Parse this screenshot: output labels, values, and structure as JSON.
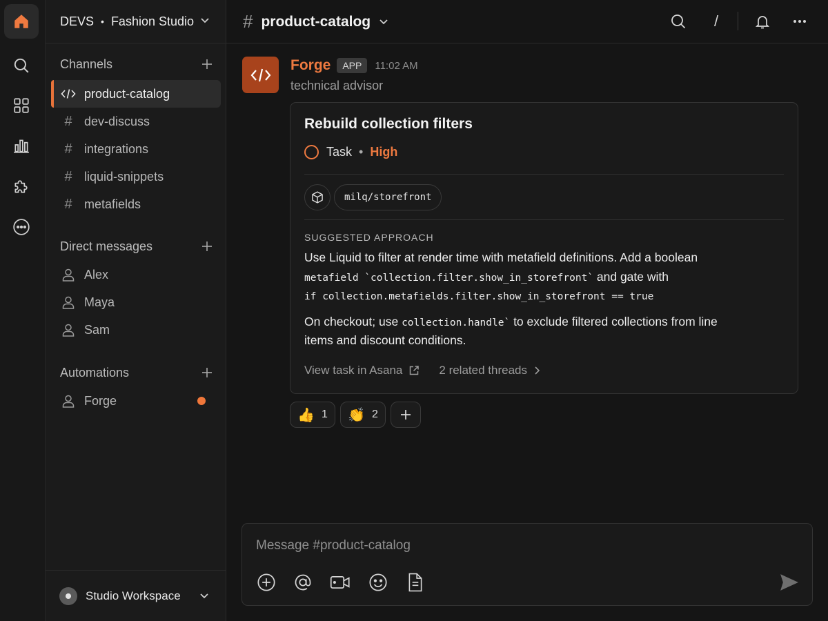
{
  "workspace": {
    "org": "DEVS",
    "separator": "•",
    "name": "Fashion Studio",
    "footer_name": "Studio Workspace"
  },
  "rail": {
    "icons": [
      "home-icon",
      "search-icon",
      "apps-grid-icon",
      "analytics-icon",
      "puzzle-icon",
      "more-circle-icon"
    ],
    "active": "home-icon"
  },
  "sidebar": {
    "channels_label": "Channels",
    "channels": [
      {
        "label": "product-catalog",
        "icon": "code-icon",
        "active": true
      },
      {
        "label": "dev-discuss",
        "icon": "hash"
      },
      {
        "label": "integrations",
        "icon": "hash"
      },
      {
        "label": "liquid-snippets",
        "icon": "hash"
      },
      {
        "label": "metafields",
        "icon": "hash"
      }
    ],
    "dm_label": "Direct messages",
    "dms": [
      {
        "label": "Alex"
      },
      {
        "label": "Maya"
      },
      {
        "label": "Sam"
      }
    ],
    "automations_label": "Automations",
    "automations": [
      {
        "label": "Forge",
        "unread": true
      }
    ],
    "hash_glyph": "#"
  },
  "topbar": {
    "hash": "#",
    "channel": "product-catalog",
    "slash": "/"
  },
  "message": {
    "sender": "Forge",
    "badge": "APP",
    "time": "11:02 AM",
    "subtitle": "technical advisor",
    "card": {
      "title": "Rebuild collection filters",
      "type": "Task",
      "dot": "•",
      "priority": "High",
      "repo": "milq/storefront",
      "section_label": "SUGGESTED APPROACH",
      "p1_a": "Use Liquid to filter at render time with metafield definitions. Add a boolean",
      "p1_b_code": "metafield `collection.filter.show_in_storefront`",
      "p1_b_text": " and gate with",
      "p1_c_code": "if collection.metafields.filter.show_in_storefront == true",
      "p2_a_text": "On checkout; use ",
      "p2_a_code": "collection.handle`",
      "p2_a_rest": " to exclude filtered collections from line",
      "p2_b": "items and discount conditions.",
      "link_asana": "View task in Asana",
      "link_threads": "2 related threads"
    },
    "reactions": [
      {
        "emoji": "👍",
        "count": "1"
      },
      {
        "emoji": "👏",
        "count": "2"
      }
    ]
  },
  "composer": {
    "placeholder": "Message #product-catalog"
  },
  "colors": {
    "accent": "#ef7a40",
    "avatar_bg": "#a8431c",
    "bg": "#151515"
  }
}
